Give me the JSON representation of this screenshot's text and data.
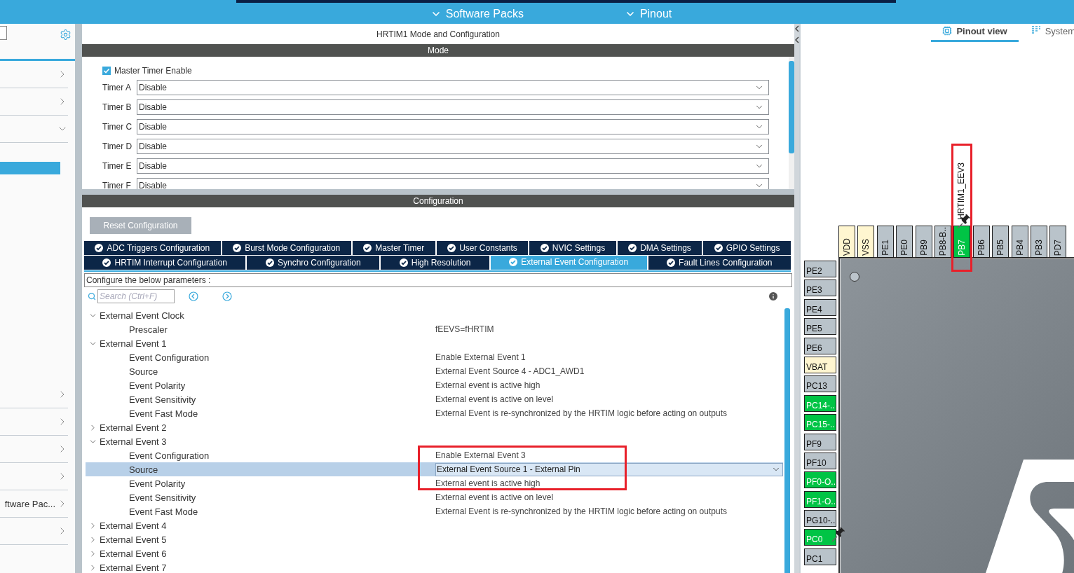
{
  "header": {
    "menus": [
      {
        "label": "Software Packs"
      },
      {
        "label": "Pinout"
      }
    ]
  },
  "sidebar": {
    "top_items": [
      {
        "expanded": false
      },
      {
        "expanded": false
      },
      {
        "expanded": true,
        "children": [
          {
            "selected": true
          }
        ]
      }
    ],
    "bottom_items": [
      {
        "expanded": false
      },
      {
        "expanded": false
      },
      {
        "expanded": false
      },
      {
        "expanded": false
      },
      {
        "label": "ftware Pac...",
        "expanded": false
      },
      {
        "expanded": false
      }
    ]
  },
  "panel": {
    "title": "HRTIM1 Mode and Configuration",
    "mode": {
      "title": "Mode",
      "master_timer": {
        "label": "Master Timer Enable",
        "checked": true
      },
      "timers": [
        {
          "label": "Timer A",
          "value": "Disable"
        },
        {
          "label": "Timer B",
          "value": "Disable"
        },
        {
          "label": "Timer C",
          "value": "Disable"
        },
        {
          "label": "Timer D",
          "value": "Disable"
        },
        {
          "label": "Timer E",
          "value": "Disable"
        },
        {
          "label": "Timer F",
          "value": "Disable"
        }
      ]
    },
    "configuration": {
      "title": "Configuration",
      "reset_button": "Reset Configuration",
      "tab_rows": [
        {
          "tabs": [
            {
              "label": "ADC Triggers Configuration",
              "selected": false
            },
            {
              "label": "Burst Mode Configuration",
              "selected": false
            },
            {
              "label": "Master Timer",
              "selected": false
            },
            {
              "label": "User Constants",
              "selected": false
            },
            {
              "label": "NVIC Settings",
              "selected": false
            },
            {
              "label": "DMA Settings",
              "selected": false
            },
            {
              "label": "GPIO Settings",
              "selected": false
            }
          ]
        },
        {
          "tabs": [
            {
              "label": "HRTIM Interrupt Configuration",
              "selected": false
            },
            {
              "label": "Synchro Configuration",
              "selected": false
            },
            {
              "label": "High Resolution",
              "selected": false
            },
            {
              "label": "External Event Configuration",
              "selected": true
            },
            {
              "label": "Fault Lines Configuration",
              "selected": false
            }
          ]
        }
      ],
      "hint": "Configure the below parameters :",
      "search": {
        "placeholder": "Search (Ctrl+F)"
      },
      "tree": [
        {
          "label": "External Event Clock",
          "expanded": true,
          "children": [
            {
              "label": "Prescaler",
              "value": "fEEVS=fHRTIM",
              "selected": false
            }
          ]
        },
        {
          "label": "External Event 1",
          "expanded": true,
          "children": [
            {
              "label": "Event Configuration",
              "value": "Enable External Event 1",
              "selected": false
            },
            {
              "label": "Source",
              "value": "External Event Source 4 -  ADC1_AWD1",
              "selected": false
            },
            {
              "label": "Event Polarity",
              "value": "External event is active high",
              "selected": false
            },
            {
              "label": "Event Sensitivity",
              "value": "External event is active on level",
              "selected": false
            },
            {
              "label": "Event Fast Mode",
              "value": "External Event is re-synchronized by the HRTIM logic before acting on outputs",
              "selected": false
            }
          ]
        },
        {
          "label": "External Event 2",
          "expanded": false
        },
        {
          "label": "External Event 3",
          "expanded": true,
          "children": [
            {
              "label": "Event Configuration",
              "value": "Enable External Event 3",
              "selected": false,
              "framed": true
            },
            {
              "label": "Source",
              "value": "External Event Source 1 - External Pin",
              "selected": true,
              "framed": true
            },
            {
              "label": "Event Polarity",
              "value": "External event is active high",
              "selected": false
            },
            {
              "label": "Event Sensitivity",
              "value": "External event is active on level",
              "selected": false
            },
            {
              "label": "Event Fast Mode",
              "value": "External Event is re-synchronized by the HRTIM logic before acting on outputs",
              "selected": false
            }
          ]
        },
        {
          "label": "External Event 4",
          "expanded": false
        },
        {
          "label": "External Event 5",
          "expanded": false
        },
        {
          "label": "External Event 6",
          "expanded": false
        },
        {
          "label": "External Event 7",
          "expanded": false
        }
      ]
    }
  },
  "pinout": {
    "tabs": [
      {
        "label": "Pinout view",
        "selected": true
      },
      {
        "label": "System",
        "selected": false
      }
    ],
    "top_pins": [
      {
        "name": "VDD",
        "kind": "power"
      },
      {
        "name": "VSS",
        "kind": "power"
      },
      {
        "name": "PE1",
        "kind": "io"
      },
      {
        "name": "PE0",
        "kind": "io"
      },
      {
        "name": "PB9",
        "kind": "io"
      },
      {
        "name": "PB8-B..",
        "kind": "io"
      },
      {
        "name": "PB7",
        "kind": "assigned",
        "signal": "HRTIM1_EEV3",
        "pinned": true,
        "framed": true
      },
      {
        "name": "PB6",
        "kind": "io"
      },
      {
        "name": "PB5",
        "kind": "io"
      },
      {
        "name": "PB4",
        "kind": "io"
      },
      {
        "name": "PB3",
        "kind": "io"
      },
      {
        "name": "PD7",
        "kind": "io"
      }
    ],
    "left_pins": [
      {
        "name": "PE2",
        "kind": "io"
      },
      {
        "name": "PE3",
        "kind": "io"
      },
      {
        "name": "PE4",
        "kind": "io"
      },
      {
        "name": "PE5",
        "kind": "io"
      },
      {
        "name": "PE6",
        "kind": "io"
      },
      {
        "name": "VBAT",
        "kind": "power"
      },
      {
        "name": "PC13",
        "kind": "io"
      },
      {
        "name": "PC14-..",
        "kind": "assigned"
      },
      {
        "name": "PC15-..",
        "kind": "assigned"
      },
      {
        "name": "PF9",
        "kind": "io"
      },
      {
        "name": "PF10",
        "kind": "io"
      },
      {
        "name": "PF0-O..",
        "kind": "assigned"
      },
      {
        "name": "PF1-O..",
        "kind": "assigned"
      },
      {
        "name": "PG10-..",
        "kind": "io"
      },
      {
        "name": "PC0",
        "kind": "assigned",
        "pinned": true
      },
      {
        "name": "PC1",
        "kind": "io"
      }
    ]
  }
}
